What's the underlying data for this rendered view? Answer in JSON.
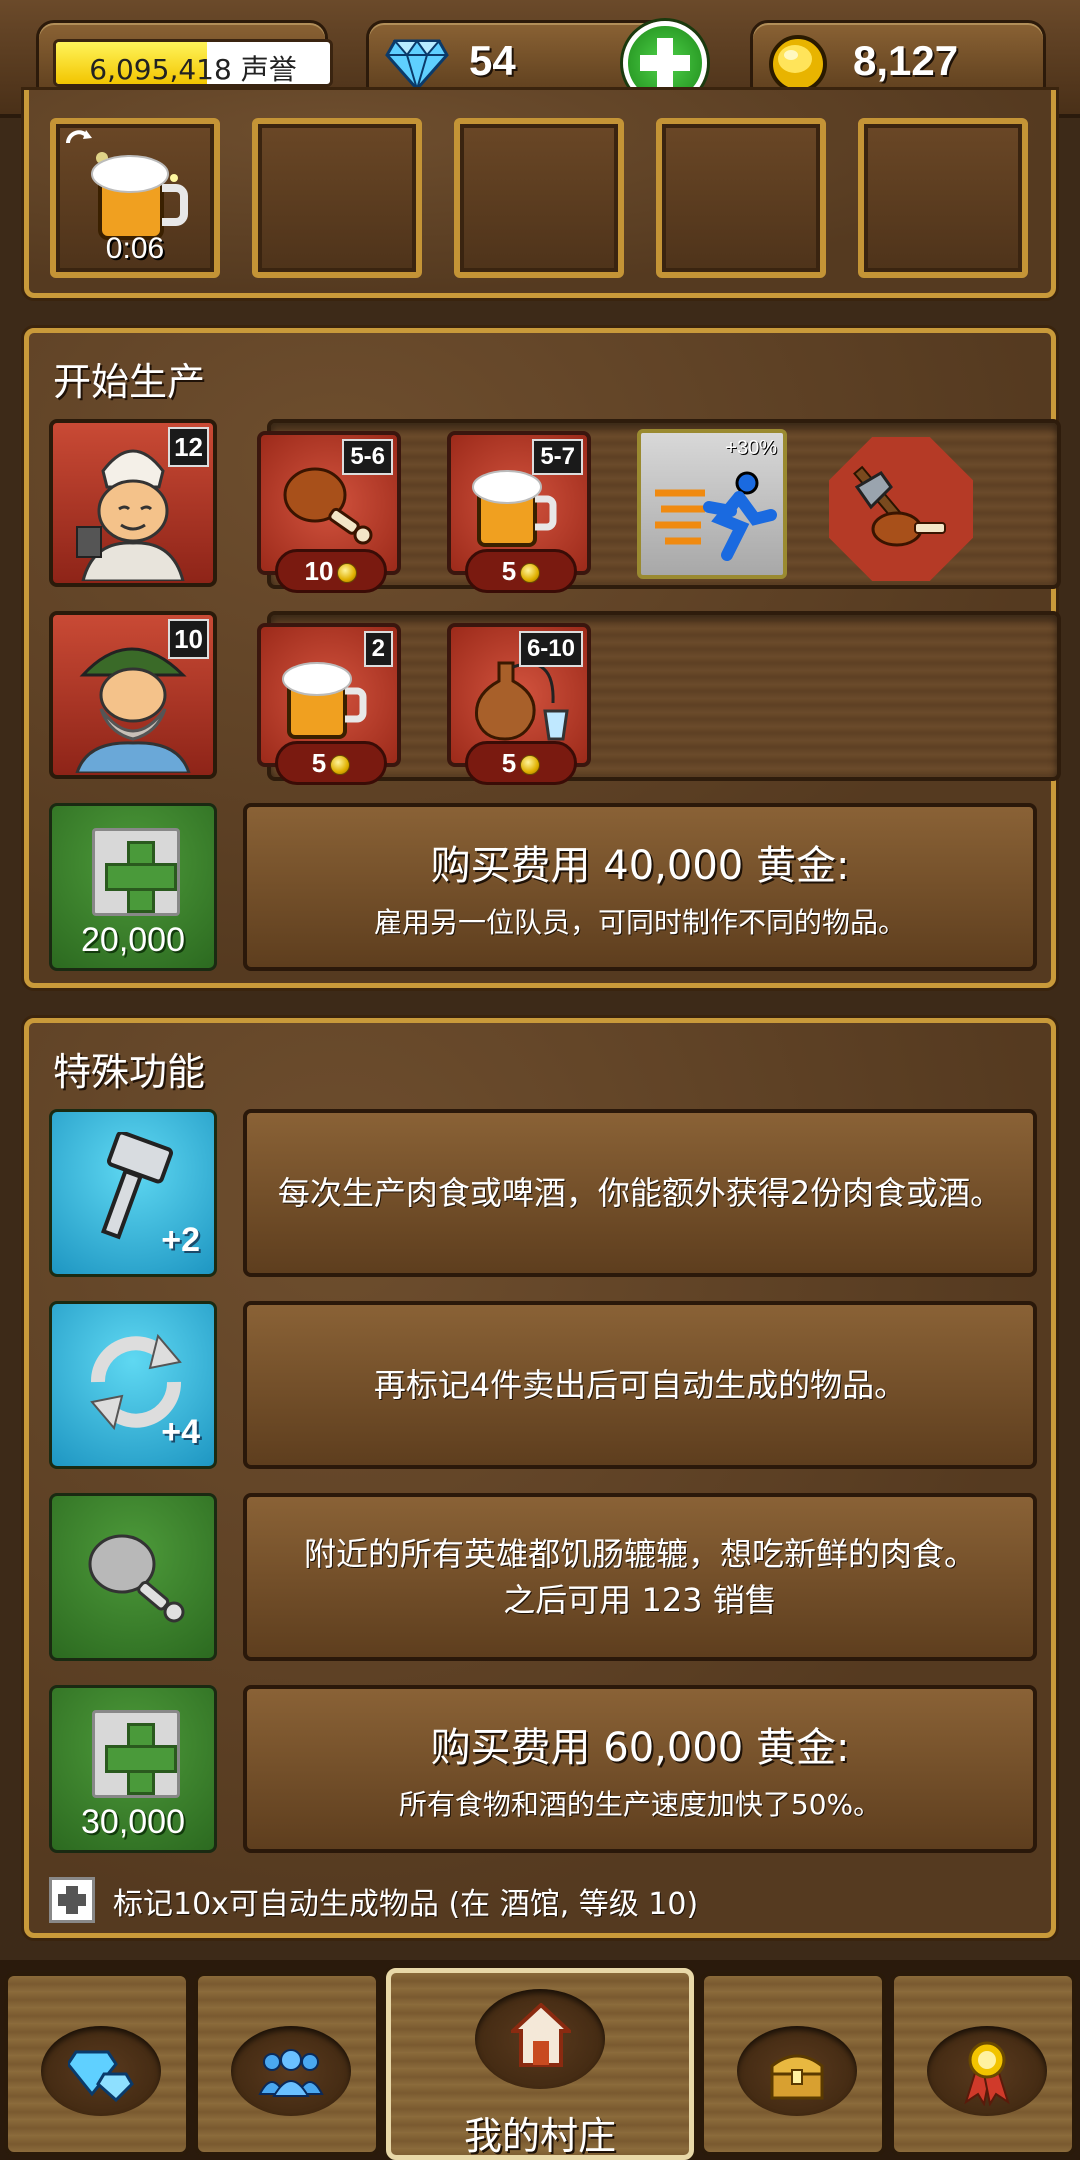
{
  "top_bar": {
    "reputation_value": "6,095,418",
    "reputation_label": "声誉",
    "reputation_progress": 0.55,
    "gems": "54",
    "gold": "8,127"
  },
  "queue": {
    "timer": "0:06"
  },
  "production": {
    "title": "开始生产",
    "workers": [
      {
        "level": "12",
        "items": [
          {
            "name": "roast-chicken-leg",
            "yield": "5-6",
            "price": "10"
          },
          {
            "name": "beer-mug",
            "yield": "5-7",
            "price": "5"
          },
          {
            "name": "speed-boost",
            "bonus": "+30%"
          },
          {
            "name": "axe-meat"
          }
        ]
      },
      {
        "level": "10",
        "items": [
          {
            "name": "beer-mug",
            "yield": "2",
            "price": "5"
          },
          {
            "name": "wine-flask",
            "yield": "6-10",
            "price": "5"
          }
        ]
      }
    ],
    "hire": {
      "cost": "20,000",
      "title": "购买费用 40,000 黄金:",
      "subtitle": "雇用另一位队员，可同时制作不同的物品。"
    }
  },
  "special": {
    "title": "特殊功能",
    "features": [
      {
        "icon": "hammer-icon",
        "badge": "+2",
        "text": "每次生产肉食或啤酒，你能额外获得2份肉食或酒。"
      },
      {
        "icon": "refresh-icon",
        "badge": "+4",
        "text": "再标记4件卖出后可自动生成的物品。"
      },
      {
        "icon": "chicken-leg-icon",
        "text": "附近的所有英雄都饥肠辘辘，想吃新鲜的肉食。",
        "text2": "之后可用 123 销售"
      }
    ],
    "buy": {
      "cost": "30,000",
      "title": "购买费用 60,000 黄金:",
      "subtitle": "所有食物和酒的生产速度加快了50%。"
    },
    "footer": "标记10x可自动生成物品 (在 酒馆, 等级 10)"
  },
  "nav": {
    "active_label": "我的村庄"
  },
  "colors": {
    "panel_border": "#c99a3a",
    "wood_dark": "#3d2a18",
    "item_red": "#c94a35",
    "green": "#3a8a2e",
    "cyan": "#2aa8d4"
  }
}
